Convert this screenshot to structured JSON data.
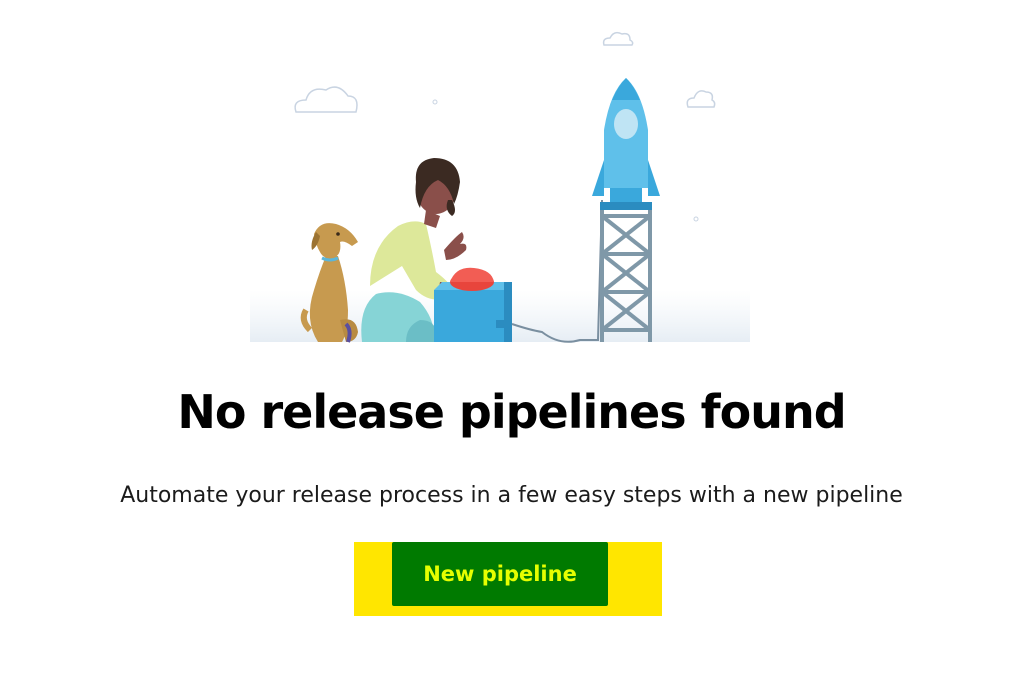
{
  "empty_state": {
    "title": "No release pipelines found",
    "subtitle": "Automate your release process in a few easy steps with a new pipeline",
    "button_label": "New pipeline"
  },
  "colors": {
    "button_bg": "#007a00",
    "button_text": "#e6ff00",
    "highlight": "#ffe600"
  }
}
